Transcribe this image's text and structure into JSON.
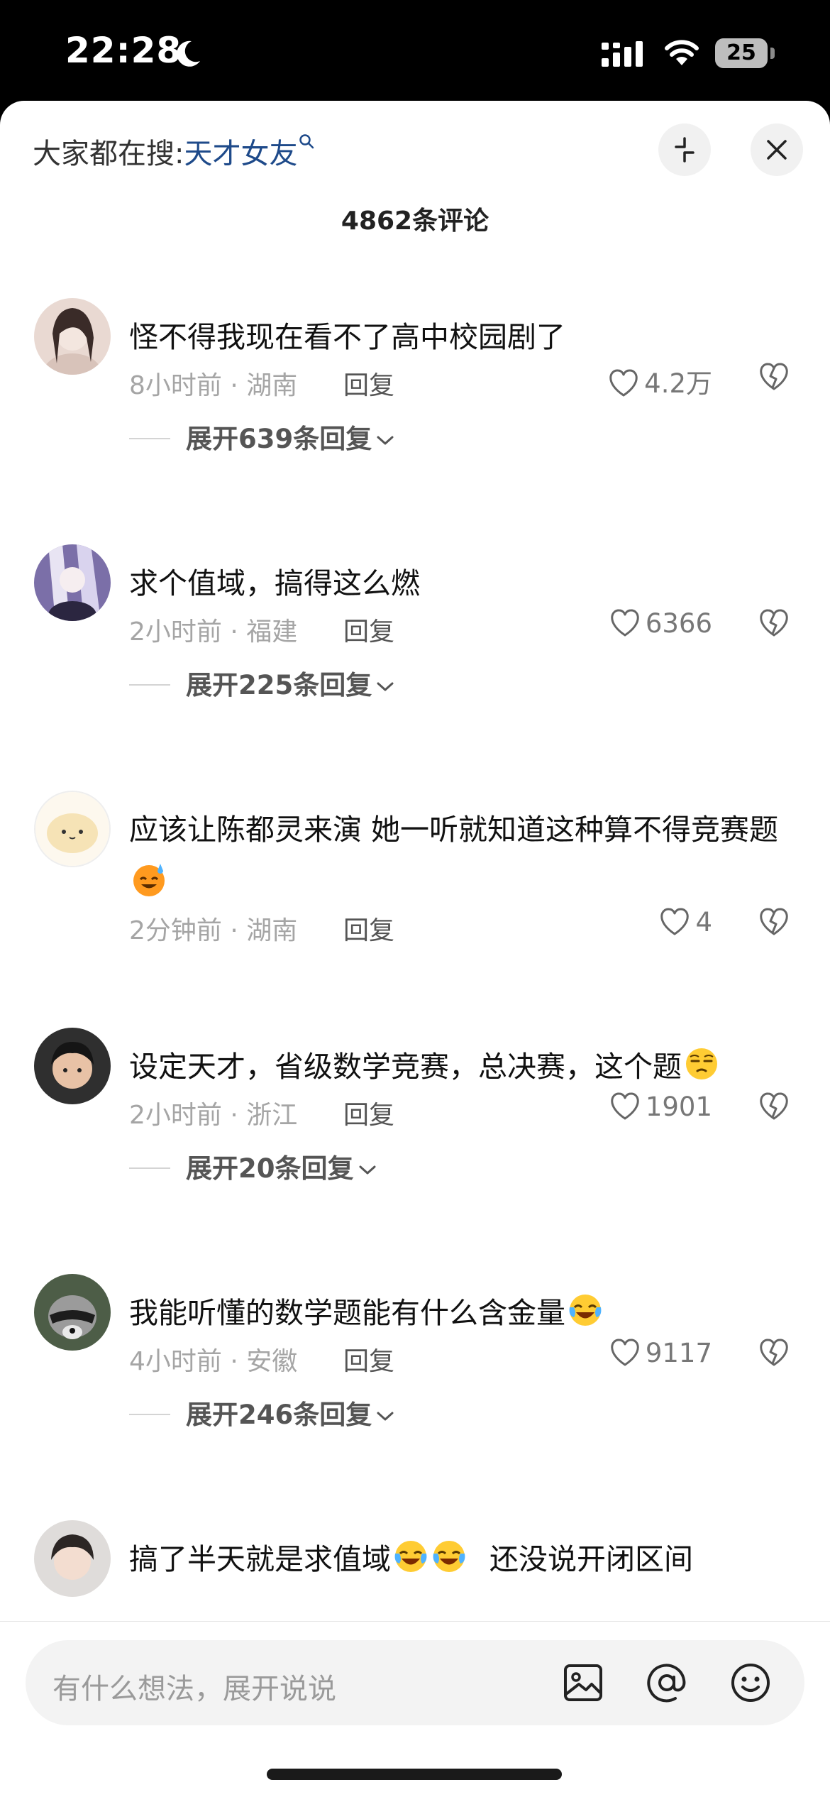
{
  "status_bar": {
    "time": "22:28",
    "battery": "25"
  },
  "header": {
    "search_prefix": "大家都在搜:",
    "search_keyword": "天才女友",
    "comment_count": "4862条评论"
  },
  "comments": [
    {
      "text": "怪不得我现在看不了高中校园剧了",
      "meta": "8小时前 · 湖南",
      "reply_label": "回复",
      "likes": "4.2万",
      "expand": "展开639条回复",
      "avatar_color": "#e9d9d2"
    },
    {
      "text": "求个值域，搞得这么燃",
      "meta": "2小时前 · 福建",
      "reply_label": "回复",
      "likes": "6366",
      "expand": "展开225条回复",
      "avatar_color": "#7b6fa8"
    },
    {
      "text": "应该让陈都灵来演 她一听就知道这种算不得竞赛题",
      "meta": "2分钟前 · 湖南",
      "reply_label": "回复",
      "likes": "4",
      "expand": "",
      "avatar_color": "#fbf1d8"
    },
    {
      "text": "设定天才，省级数学竞赛，总决赛，这个题",
      "meta": "2小时前 · 浙江",
      "reply_label": "回复",
      "likes": "1901",
      "expand": "展开20条回复",
      "avatar_color": "#2f2f2f"
    },
    {
      "text": "我能听懂的数学题能有什么含金量",
      "meta": "4小时前 · 安徽",
      "reply_label": "回复",
      "likes": "9117",
      "expand": "展开246条回复",
      "avatar_color": "#4d5d47"
    },
    {
      "text_a": "搞了半天就是求值域",
      "text_b": "还没说开闭区间",
      "avatar_color": "#dfdcda"
    }
  ],
  "input": {
    "placeholder": "有什么想法，展开说说"
  },
  "icons": {
    "status": [
      "moon-icon",
      "cellular-signal-icon",
      "wifi-icon",
      "battery-icon"
    ],
    "header": [
      "search-icon",
      "collapse-icon",
      "close-icon"
    ],
    "comment": [
      "heart-icon",
      "dislike-icon",
      "chevron-down-icon"
    ],
    "input": [
      "image-icon",
      "at-icon",
      "emoji-icon"
    ]
  }
}
